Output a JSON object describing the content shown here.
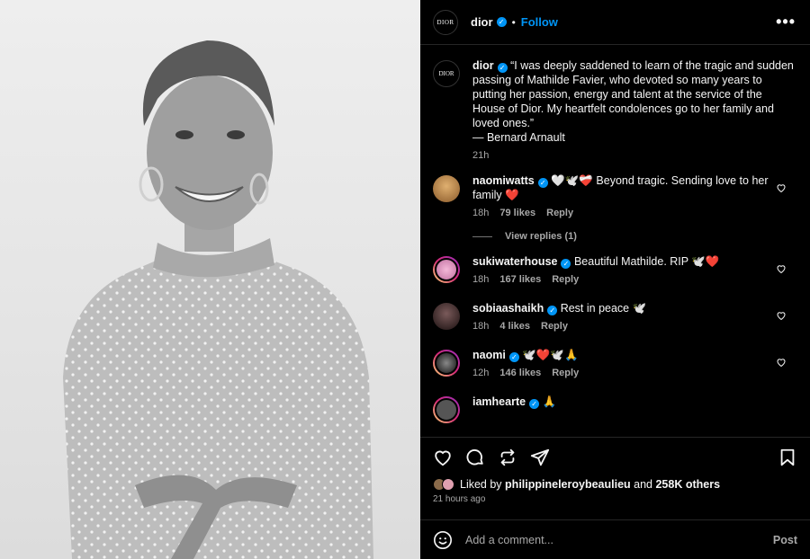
{
  "post": {
    "username": "dior",
    "follow_label": "Follow",
    "dot": "•",
    "more": "•••",
    "avatar_text": "DIOR",
    "caption": "“I was deeply saddened to learn of the tragic and sudden passing of Mathilde Favier, who devoted so many years to putting her passion, energy and talent at the service of the House of Dior. My heartfelt condolences go to her family and loved ones.”",
    "caption_author": "— Bernard Arnault",
    "caption_time": "21h"
  },
  "comments": [
    {
      "user": "naomiwatts",
      "text": "🤍🕊️❤️‍🩹 Beyond tragic. Sending love to her family ❤️",
      "time": "18h",
      "likes": "79 likes",
      "reply": "Reply",
      "avatar_color": "#b07a3a"
    },
    {
      "user": "sukiwaterhouse",
      "text": "Beautiful Mathilde. RIP 🕊️❤️",
      "time": "18h",
      "likes": "167 likes",
      "reply": "Reply",
      "avatar_color": "#e8a0c8"
    },
    {
      "user": "sobiaashaikh",
      "text": "Rest in peace 🕊️",
      "time": "18h",
      "likes": "4 likes",
      "reply": "Reply",
      "avatar_color": "#3a2a2a"
    },
    {
      "user": "naomi",
      "text": "🕊️❤️🕊️🙏",
      "time": "12h",
      "likes": "146 likes",
      "reply": "Reply",
      "avatar_color": "#222222"
    },
    {
      "user": "iamhearte",
      "text": "🙏",
      "time": "",
      "likes": "",
      "reply": "",
      "avatar_color": "#555555"
    }
  ],
  "view_replies": "View replies (1)",
  "likes": {
    "liked_by_prefix": "Liked by",
    "liked_by_user": "philippineleroybeaulieu",
    "and": "and",
    "others": "258K others",
    "time_ago": "21 hours ago"
  },
  "add_comment": {
    "placeholder": "Add a comment...",
    "post_label": "Post"
  },
  "colors": {
    "accent": "#0095f6",
    "background": "#000000",
    "secondary_text": "#a8a8a8"
  }
}
